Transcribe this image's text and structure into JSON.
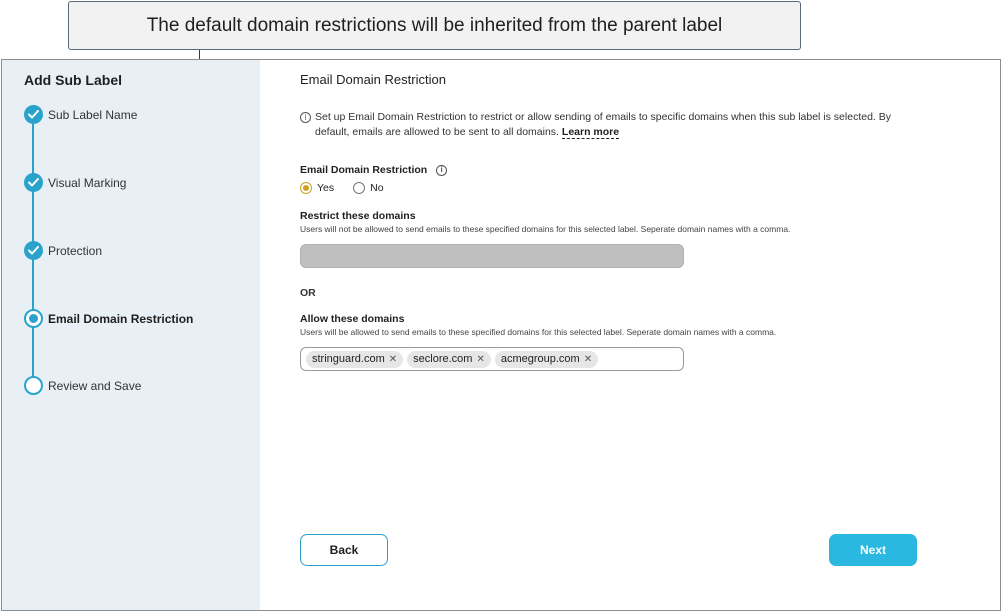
{
  "callout": {
    "text": "The default domain restrictions will be inherited from the parent label"
  },
  "sidebar": {
    "title": "Add Sub Label",
    "steps": [
      {
        "label": "Sub Label Name",
        "status": "done"
      },
      {
        "label": "Visual Marking",
        "status": "done"
      },
      {
        "label": "Protection",
        "status": "done"
      },
      {
        "label": "Email Domain Restriction",
        "status": "current"
      },
      {
        "label": "Review and Save",
        "status": "pending"
      }
    ]
  },
  "main": {
    "section_title": "Email Domain Restriction",
    "info_text": "Set up Email Domain Restriction to restrict or allow sending of emails to specific domains when this sub label is selected. By default, emails are allowed to be sent to all domains.",
    "learn_more": "Learn more",
    "restriction_label": "Email Domain Restriction",
    "options": {
      "yes": "Yes",
      "no": "No",
      "selected": "Yes"
    },
    "restrict": {
      "label": "Restrict these domains",
      "help": "Users will not be allowed to send emails to these specified domains for this selected label. Seperate domain names with a comma."
    },
    "or_text": "OR",
    "allow": {
      "label": "Allow these domains",
      "help": "Users will be allowed to send emails to these specified domains for this selected label. Seperate domain names with a comma.",
      "domains": [
        "stringuard.com",
        "seclore.com",
        "acmegroup.com"
      ]
    },
    "buttons": {
      "back": "Back",
      "next": "Next"
    }
  },
  "colors": {
    "accent": "#2aa3cc",
    "next_button": "#2ab7e0",
    "radio_selected": "#c9a227",
    "sidebar_bg": "#e8eff5"
  },
  "icons": {
    "check": "check-icon",
    "info": "info-icon",
    "remove": "close-icon"
  }
}
